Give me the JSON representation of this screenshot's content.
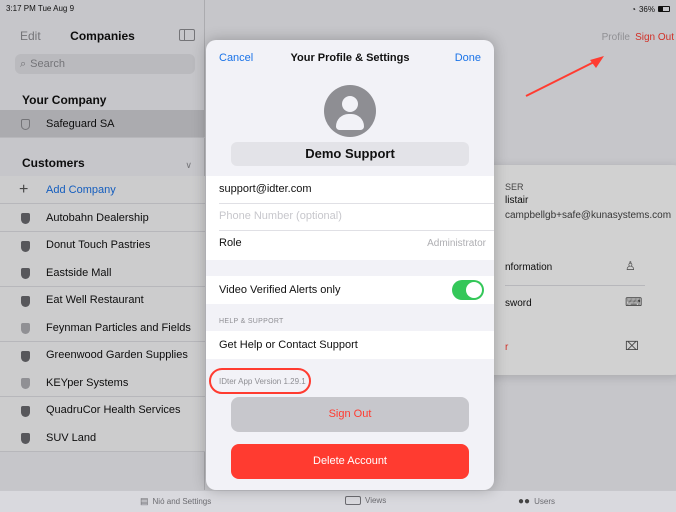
{
  "status": {
    "time": "3:17 PM  Tue Aug 9",
    "battery": "36%"
  },
  "sidebar": {
    "edit": "Edit",
    "title": "Companies",
    "search_placeholder": "Search",
    "your_company_header": "Your Company",
    "your_company": "Safeguard SA",
    "customers_header": "Customers",
    "add_company": "Add Company",
    "customers": [
      "Autobahn Dealership",
      "Donut Touch Pastries",
      "Eastside Mall",
      "Eat Well Restaurant",
      "Feynman Particles and Fields",
      "Greenwood Garden Supplies",
      "KEYper Systems",
      "QuadruCor Health Services",
      "SUV Land"
    ]
  },
  "background": {
    "profile": "Profile",
    "sign_out": "Sign Out",
    "user_label": "SER",
    "user_name": "listair",
    "user_email": "campbellgb+safe@kunasystems.com",
    "information": "nformation",
    "password": "sword",
    "delete": "r"
  },
  "tabbar": {
    "tab1": "Nió and Settings",
    "tab2": "Views",
    "tab3": "Users"
  },
  "modal": {
    "cancel": "Cancel",
    "title": "Your Profile & Settings",
    "done": "Done",
    "name": "Demo Support",
    "email": "support@idter.com",
    "phone_placeholder": "Phone Number (optional)",
    "role_label": "Role",
    "role_value": "Administrator",
    "video_alerts": "Video Verified Alerts only",
    "video_alerts_on": true,
    "help_header": "HELP & SUPPORT",
    "help_link": "Get Help or Contact Support",
    "version": "IDter App Version 1.29.1",
    "sign_out": "Sign Out",
    "delete_account": "Delete Account"
  },
  "colors": {
    "accent": "#1a73e8",
    "destructive": "#ff3b30",
    "toggle_on": "#34c759"
  }
}
